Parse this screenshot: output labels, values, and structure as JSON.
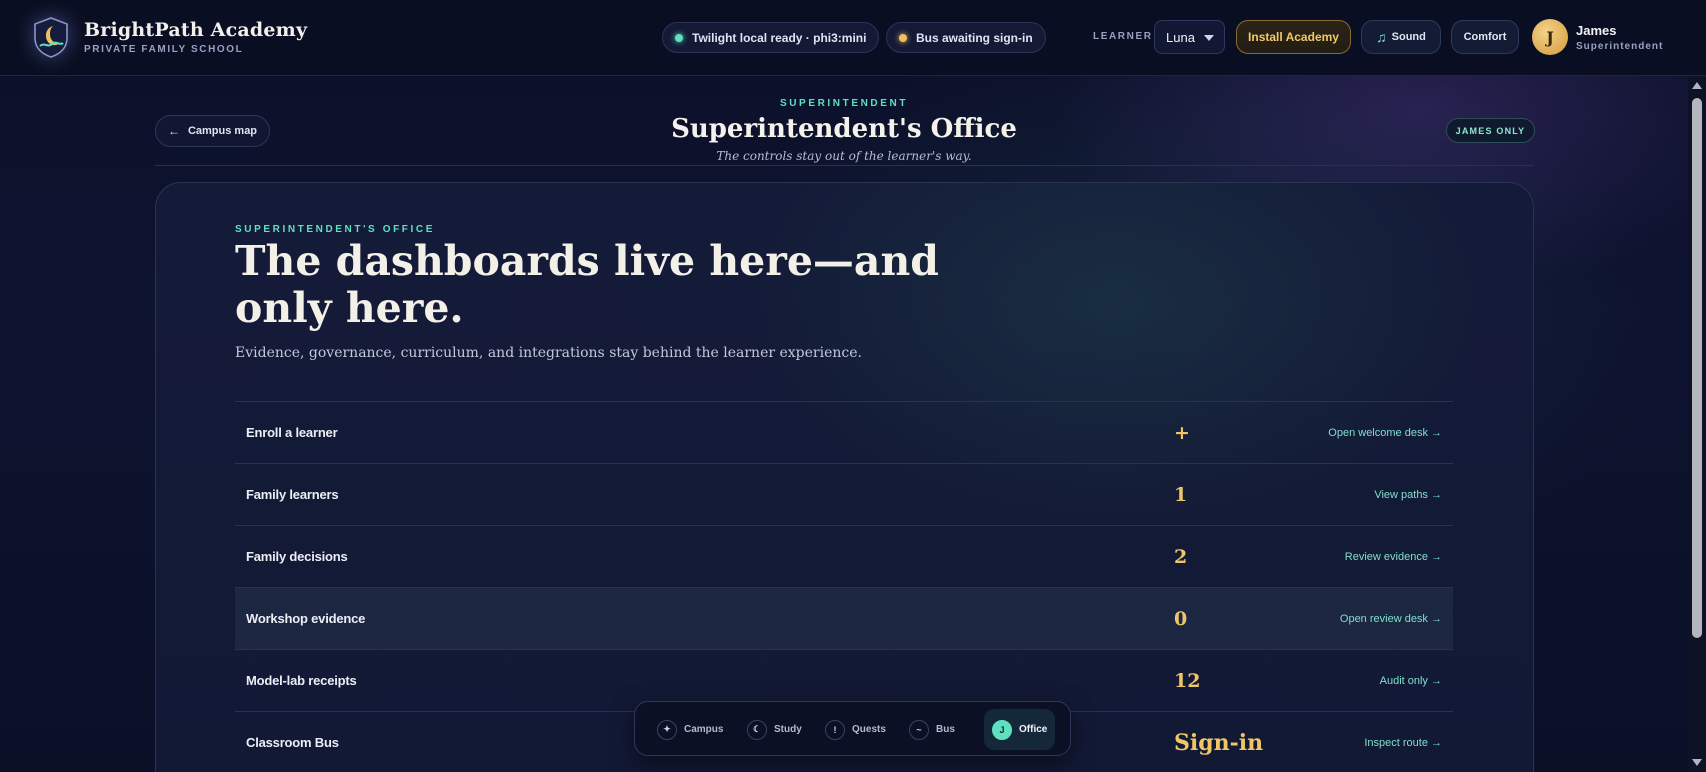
{
  "brand": {
    "title": "BrightPath Academy",
    "subtitle": "PRIVATE FAMILY SCHOOL",
    "logo_icon": "shield-moon-logo"
  },
  "status": {
    "model": "Twilight local ready · phi3:mini",
    "bus": "Bus awaiting sign-in",
    "model_color": "#5fe0c0",
    "bus_color": "#f0c060"
  },
  "learner": {
    "label": "LEARNER",
    "selected": "Luna"
  },
  "toolbar": {
    "install_label": "Install Academy",
    "sound_label": "Sound",
    "sound_icon": "music-note-icon",
    "comfort_label": "Comfort"
  },
  "user": {
    "initial": "J",
    "name": "James",
    "role": "Superintendent"
  },
  "header": {
    "back_label": "Campus map",
    "eyebrow": "SUPERINTENDENT",
    "title": "Superintendent's Office",
    "tagline": "The controls stay out of the learner's way.",
    "badge": "JAMES ONLY"
  },
  "panel": {
    "eyebrow": "SUPERINTENDENT'S OFFICE",
    "title": "The dashboards live here—and only here.",
    "description": "Evidence, governance, curriculum, and integrations stay behind the learner experience.",
    "rows": [
      {
        "label": "Enroll a learner",
        "value": "+",
        "link": "Open welcome desk →"
      },
      {
        "label": "Family learners",
        "value": "1",
        "link": "View paths →"
      },
      {
        "label": "Family decisions",
        "value": "2",
        "link": "Review evidence →"
      },
      {
        "label": "Workshop evidence",
        "value": "0",
        "link": "Open review desk →"
      },
      {
        "label": "Model-lab receipts",
        "value": "12",
        "link": "Audit only →"
      },
      {
        "label": "Classroom Bus",
        "value": "Sign-in",
        "link": "Inspect route →"
      }
    ]
  },
  "nav": {
    "items": [
      {
        "label": "Campus",
        "icon": "✦"
      },
      {
        "label": "Study",
        "icon": "☾"
      },
      {
        "label": "Quests",
        "icon": "!"
      },
      {
        "label": "Bus",
        "icon": "~"
      },
      {
        "label": "Office",
        "icon": "J"
      }
    ],
    "active": "Office"
  },
  "colors": {
    "accent": "#5fe0c0",
    "gold": "#f0c568",
    "background": "#0b1026"
  }
}
